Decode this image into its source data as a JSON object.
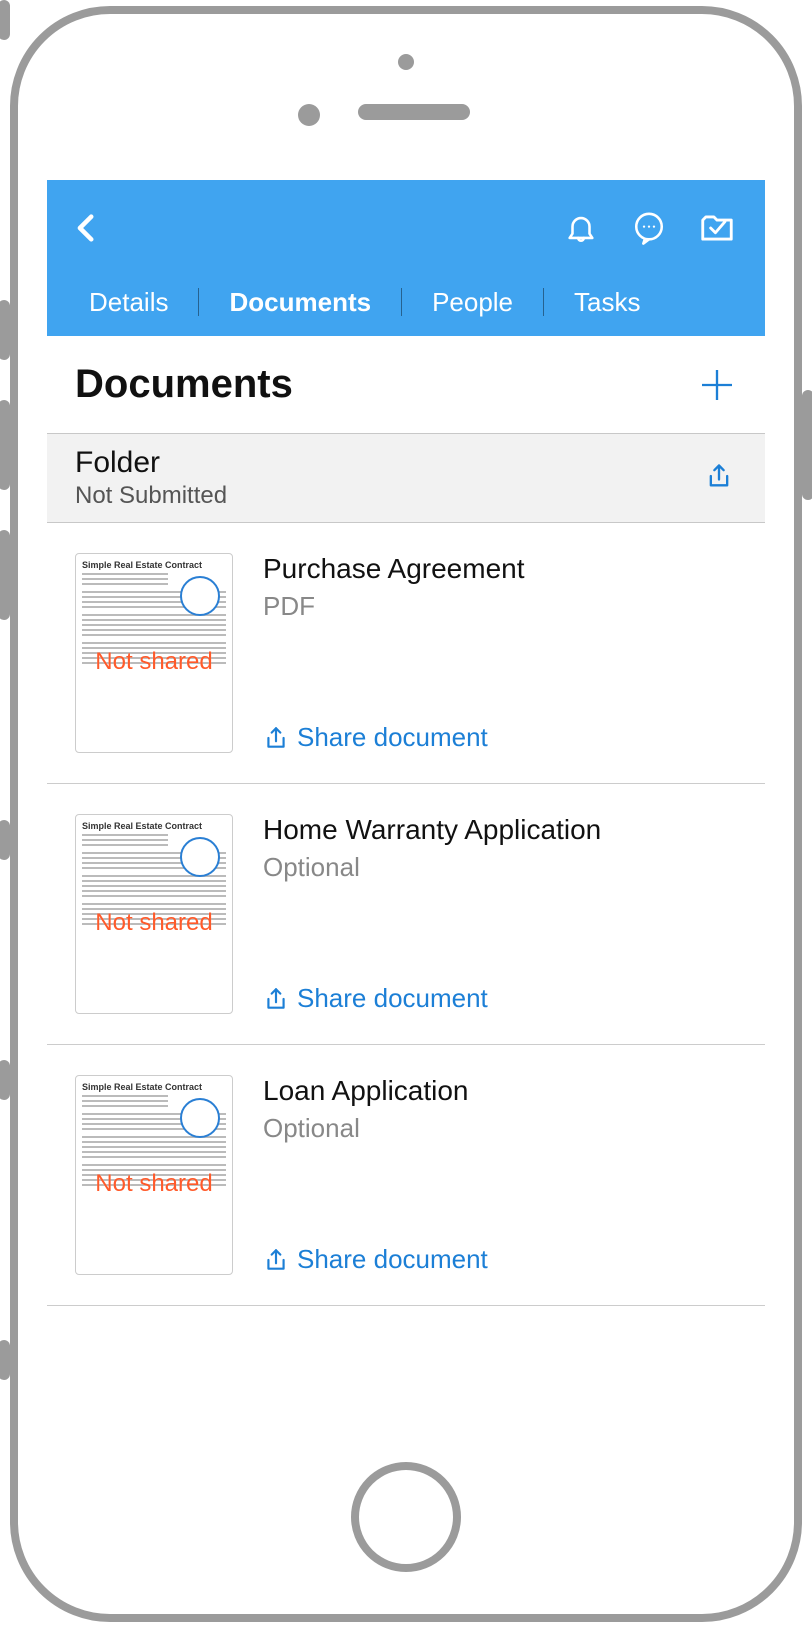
{
  "header": {
    "tabs": [
      "Details",
      "Documents",
      "People",
      "Tasks"
    ],
    "active_tab_index": 1
  },
  "page_title": "Documents",
  "folder": {
    "title": "Folder",
    "status": "Not Submitted"
  },
  "share_label": "Share document",
  "thumb_heading": "Simple Real Estate Contract",
  "thumb_watermark": "Not shared",
  "documents": [
    {
      "title": "Purchase Agreement",
      "subtitle": "PDF"
    },
    {
      "title": "Home Warranty Application",
      "subtitle": "Optional"
    },
    {
      "title": "Loan Application",
      "subtitle": "Optional"
    }
  ],
  "colors": {
    "accent": "#1c7fd6",
    "header_bg": "#40a4f0",
    "watermark": "#ff5a2a"
  }
}
